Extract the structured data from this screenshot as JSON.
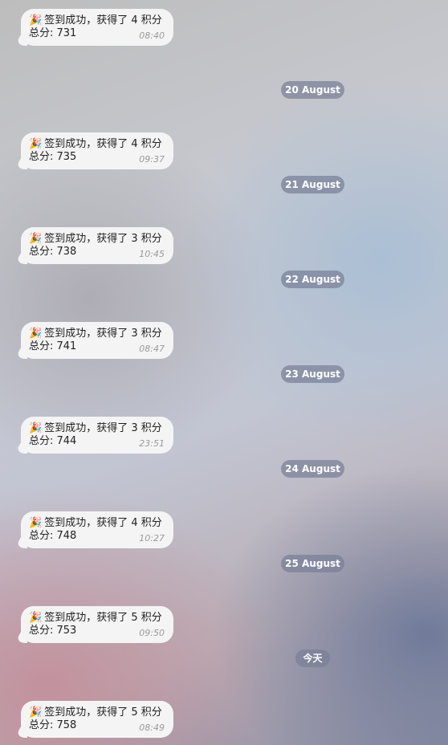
{
  "chat": {
    "messages": [
      {
        "text": "签到成功，获得了 4 积分",
        "total": "总分: 731",
        "time": "08:40",
        "icon": "party-popper-icon"
      },
      {
        "text": "签到成功，获得了 4 积分",
        "total": "总分: 735",
        "time": "09:37",
        "icon": "party-popper-icon"
      },
      {
        "text": "签到成功，获得了 3 积分",
        "total": "总分: 738",
        "time": "10:45",
        "icon": "party-popper-icon"
      },
      {
        "text": "签到成功，获得了 3 积分",
        "total": "总分: 741",
        "time": "08:47",
        "icon": "party-popper-icon"
      },
      {
        "text": "签到成功，获得了 3 积分",
        "total": "总分: 744",
        "time": "23:51",
        "icon": "party-popper-icon"
      },
      {
        "text": "签到成功，获得了 4 积分",
        "total": "总分: 748",
        "time": "10:27",
        "icon": "party-popper-icon"
      },
      {
        "text": "签到成功，获得了 5 积分",
        "total": "总分: 753",
        "time": "09:50",
        "icon": "party-popper-icon"
      },
      {
        "text": "签到成功，获得了 5 积分",
        "total": "总分: 758",
        "time": "08:49",
        "icon": "party-popper-icon"
      }
    ],
    "dates": [
      "20 August",
      "21 August",
      "22 August",
      "23 August",
      "24 August",
      "25 August",
      "今天"
    ]
  },
  "colors": {
    "bubble": "#f4f4f4",
    "date_badge": "#7880a0",
    "timestamp": "#9a9a9a"
  }
}
